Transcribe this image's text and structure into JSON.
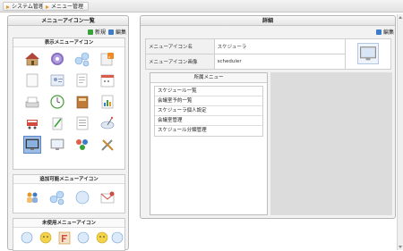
{
  "breadcrumb": {
    "items": [
      "システム管理",
      "メニュー管理"
    ]
  },
  "left_panel": {
    "title": "メニューアイコン一覧",
    "new_label": "新規",
    "edit_label": "編集",
    "sections": [
      {
        "title": "表示メニューアイコン"
      },
      {
        "title": "追加可能メニューアイコン"
      },
      {
        "title": "未使用メニューアイコン"
      }
    ]
  },
  "right_panel": {
    "title": "詳細",
    "edit_label": "編集",
    "fields": [
      {
        "label": "メニューアイコン名",
        "value": "スケジューラ"
      },
      {
        "label": "メニューアイコン画像",
        "value": "scheduler"
      }
    ],
    "assoc": {
      "title": "所属メニュー",
      "items": [
        "スケジュール一覧",
        "会議室予約一覧",
        "スケジューラ個人設定",
        "会議室管理",
        "スケジュール分類管理"
      ]
    }
  },
  "colors": {
    "accent_orange": "#e49a20",
    "new_icon": "#3aa23a",
    "edit_icon": "#3d7cc9"
  }
}
